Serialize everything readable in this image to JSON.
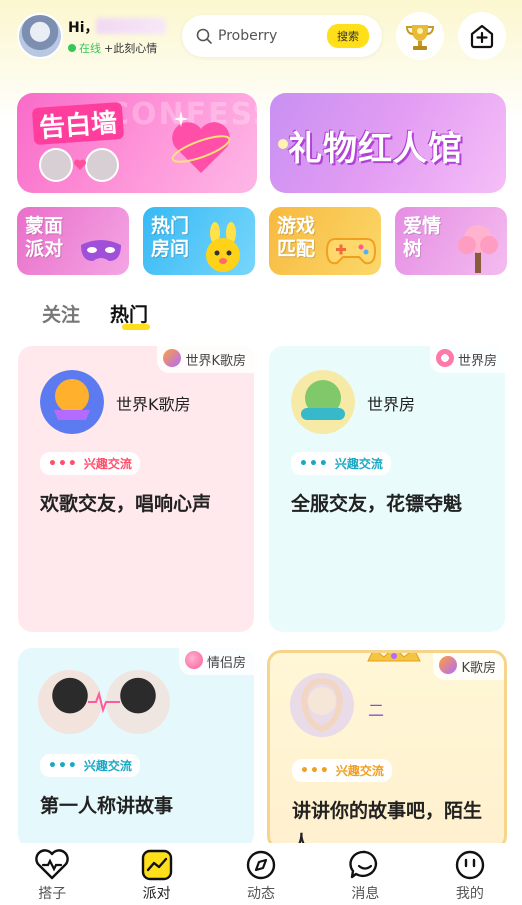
{
  "header": {
    "greeting": "Hi，",
    "status": "在线",
    "mood": "+此刻心情",
    "search": {
      "placeholder": "Proberry",
      "button": "搜索"
    }
  },
  "banners": [
    {
      "title": "告白墙",
      "bg_text": "CONFESS",
      "color": "#f86bc9"
    },
    {
      "title": "礼物红人馆",
      "color": "#d38ef4"
    }
  ],
  "categories": [
    {
      "label": "蒙面派对",
      "line1": "蒙面",
      "line2": "派对"
    },
    {
      "label": "热门房间",
      "line1": "热门",
      "line2": "房间"
    },
    {
      "label": "游戏匹配",
      "line1": "游戏",
      "line2": "匹配"
    },
    {
      "label": "爱情树",
      "line1": "爱情",
      "line2": "树"
    }
  ],
  "tabs": [
    {
      "label": "关注"
    },
    {
      "label": "热门"
    }
  ],
  "rooms": [
    {
      "type": "世界K歌房",
      "name": "世界K歌房",
      "tag": "兴趣交流",
      "tag_color": "#ff4f6b",
      "title": "欢歌交友，唱响心声"
    },
    {
      "type": "世界房",
      "name": "世界房",
      "tag": "兴趣交流",
      "tag_color": "#1ba8c5",
      "title": "全服交友，花镖夺魁"
    },
    {
      "type": "情侣房",
      "name": "",
      "tag": "兴趣交流",
      "tag_color": "#1ba8c5",
      "title": "第一人称讲故事"
    },
    {
      "type": "K歌房",
      "name": "二",
      "tag": "兴趣交流",
      "tag_color": "#f0a020",
      "title": "讲讲你的故事吧，陌生人"
    }
  ],
  "nav": [
    {
      "label": "搭子",
      "icon": "heart-pulse-icon"
    },
    {
      "label": "派对",
      "icon": "trend-icon"
    },
    {
      "label": "动态",
      "icon": "compass-icon"
    },
    {
      "label": "消息",
      "icon": "chat-icon"
    },
    {
      "label": "我的",
      "icon": "face-icon"
    }
  ],
  "colors": {
    "accent": "#ffde1a",
    "primary_text": "#222222"
  }
}
